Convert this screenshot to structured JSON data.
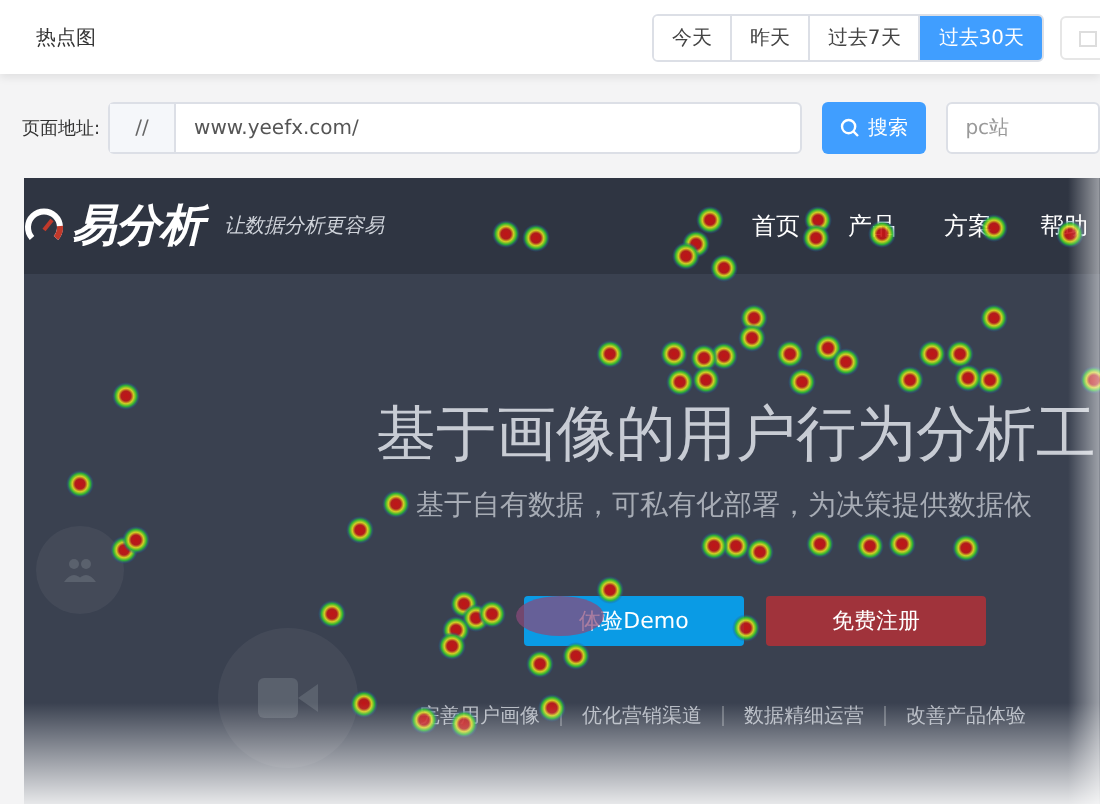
{
  "header": {
    "title": "热点图"
  },
  "date_tabs": [
    {
      "label": "今天",
      "selected": false
    },
    {
      "label": "昨天",
      "selected": false
    },
    {
      "label": "过去7天",
      "selected": false
    },
    {
      "label": "过去30天",
      "selected": true
    }
  ],
  "url_bar": {
    "label": "页面地址:",
    "prefix": "//",
    "value": "www.yeefx.com/",
    "search_button": "搜索",
    "site_select": "pc站"
  },
  "preview": {
    "logo": "易分析",
    "slogan": "让数据分析更容易",
    "nav": [
      "首页",
      "产品",
      "方案",
      "帮助"
    ],
    "headline": "基于画像的用户行为分析工",
    "subtitle": "基于自有数据，可私有化部署，为决策提供数据依",
    "buttons": [
      {
        "label": "体验Demo",
        "kind": "primary"
      },
      {
        "label": "免费注册",
        "kind": "danger"
      }
    ],
    "features": [
      "完善用户画像",
      "优化营销渠道",
      "数据精细运营",
      "改善产品体验"
    ]
  }
}
